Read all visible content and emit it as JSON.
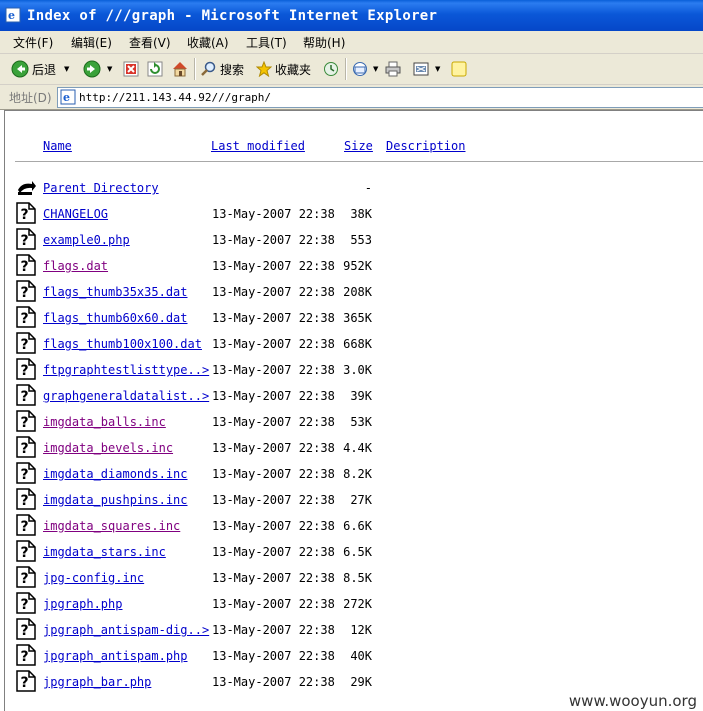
{
  "window": {
    "title": "Index of ///graph - Microsoft Internet Explorer"
  },
  "menu": [
    "文件(F)",
    "编辑(E)",
    "查看(V)",
    "收藏(A)",
    "工具(T)",
    "帮助(H)"
  ],
  "toolbar": {
    "back": "后退",
    "search": "搜索",
    "favorites": "收藏夹"
  },
  "address": {
    "label": "地址(D)",
    "url": "http://211.143.44.92///graph/"
  },
  "columns": {
    "name": "Name",
    "modified": "Last modified",
    "size": "Size",
    "description": "Description"
  },
  "parent": {
    "name": "Parent Directory",
    "size": "-"
  },
  "files": [
    {
      "name": "CHANGELOG",
      "modified": "13-May-2007 22:38",
      "size": "38K",
      "visited": false
    },
    {
      "name": "example0.php",
      "modified": "13-May-2007 22:38",
      "size": "553",
      "visited": false
    },
    {
      "name": "flags.dat",
      "modified": "13-May-2007 22:38",
      "size": "952K",
      "visited": true
    },
    {
      "name": "flags_thumb35x35.dat",
      "modified": "13-May-2007 22:38",
      "size": "208K",
      "visited": false
    },
    {
      "name": "flags_thumb60x60.dat",
      "modified": "13-May-2007 22:38",
      "size": "365K",
      "visited": false
    },
    {
      "name": "flags_thumb100x100.dat",
      "modified": "13-May-2007 22:38",
      "size": "668K",
      "visited": false
    },
    {
      "name": "ftpgraphtestlisttype..>",
      "modified": "13-May-2007 22:38",
      "size": "3.0K",
      "visited": false
    },
    {
      "name": "graphgeneraldatalist..>",
      "modified": "13-May-2007 22:38",
      "size": "39K",
      "visited": false
    },
    {
      "name": "imgdata_balls.inc",
      "modified": "13-May-2007 22:38",
      "size": "53K",
      "visited": true
    },
    {
      "name": "imgdata_bevels.inc",
      "modified": "13-May-2007 22:38",
      "size": "4.4K",
      "visited": true
    },
    {
      "name": "imgdata_diamonds.inc",
      "modified": "13-May-2007 22:38",
      "size": "8.2K",
      "visited": false
    },
    {
      "name": "imgdata_pushpins.inc",
      "modified": "13-May-2007 22:38",
      "size": "27K",
      "visited": false
    },
    {
      "name": "imgdata_squares.inc",
      "modified": "13-May-2007 22:38",
      "size": "6.6K",
      "visited": true
    },
    {
      "name": "imgdata_stars.inc",
      "modified": "13-May-2007 22:38",
      "size": "6.5K",
      "visited": false
    },
    {
      "name": "jpg-config.inc",
      "modified": "13-May-2007 22:38",
      "size": "8.5K",
      "visited": false
    },
    {
      "name": "jpgraph.php",
      "modified": "13-May-2007 22:38",
      "size": "272K",
      "visited": false
    },
    {
      "name": "jpgraph_antispam-dig..>",
      "modified": "13-May-2007 22:38",
      "size": "12K",
      "visited": false
    },
    {
      "name": "jpgraph_antispam.php",
      "modified": "13-May-2007 22:38",
      "size": "40K",
      "visited": false
    },
    {
      "name": "jpgraph_bar.php",
      "modified": "13-May-2007 22:38",
      "size": "29K",
      "visited": false
    }
  ],
  "watermark": "www.wooyun.org"
}
